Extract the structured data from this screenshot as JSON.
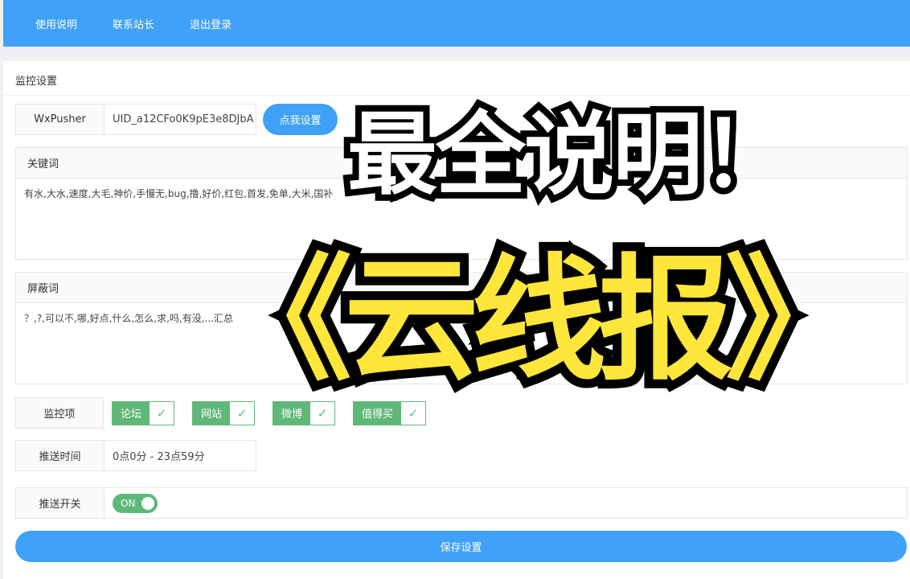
{
  "nav": {
    "items": [
      "使用说明",
      "联系站长",
      "退出登录"
    ]
  },
  "card_title": "监控设置",
  "wxpusher": {
    "label": "WxPusher",
    "value": "UID_a12CFo0K9pE3e8DJbA",
    "button": "点我设置"
  },
  "keywords": {
    "label": "关键词",
    "value": "有水,大水,速度,大毛,神价,手慢无,bug,撸,好价,红包,首发,免单,大米,国补"
  },
  "blocked": {
    "label": "屏蔽词",
    "value": "？,?,可以不,哪,好点,什么,怎么,求,吗,有没,...汇总"
  },
  "monitor": {
    "label": "监控项",
    "items": [
      "论坛",
      "网站",
      "微博",
      "值得买"
    ]
  },
  "push_time": {
    "label": "推送时间",
    "value": "0点0分 - 23点59分"
  },
  "push_switch": {
    "label": "推送开关",
    "state": "ON"
  },
  "save": "保存设置",
  "overlay": {
    "line1": "最全说明！",
    "line2": "《云线报》"
  },
  "colors": {
    "accent": "#3fa1f7",
    "success": "#5fb878",
    "title_yellow": "#ffe63b"
  }
}
